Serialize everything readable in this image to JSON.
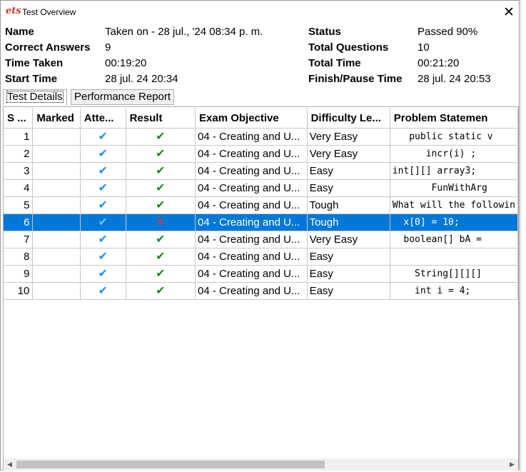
{
  "window": {
    "title": "Test Overview",
    "logo": "ets",
    "close": "✕"
  },
  "summary": {
    "name_label": "Name",
    "name_value": "Taken on - 28 jul., '24 08:34 p. m.",
    "correct_label": "Correct Answers",
    "correct_value": "9",
    "time_taken_label": "Time Taken",
    "time_taken_value": "00:19:20",
    "start_label": "Start Time",
    "start_value": "28 jul. 24 20:34",
    "status_label": "Status",
    "status_value": "Passed 90%",
    "total_q_label": "Total Questions",
    "total_q_value": "10",
    "total_time_label": "Total Time",
    "total_time_value": "00:21:20",
    "finish_label": "Finish/Pause Time",
    "finish_value": "28 jul. 24 20:53"
  },
  "tabs": [
    "Test Details",
    "Performance Report"
  ],
  "table": {
    "headers": [
      "S ...",
      "Marked",
      "Atte...",
      "Result",
      "Exam Objective",
      "Difficulty Le...",
      "Problem Statemen"
    ],
    "rows": [
      {
        "n": "1",
        "result": "pass",
        "objective": "04 - Creating and U...",
        "difficulty": "Very Easy",
        "problem": "   public static v"
      },
      {
        "n": "2",
        "result": "pass",
        "objective": "04 - Creating and U...",
        "difficulty": "Very Easy",
        "problem": "      incr(i) ;"
      },
      {
        "n": "3",
        "result": "pass",
        "objective": "04 - Creating and U...",
        "difficulty": "Easy",
        "problem": "int[][] array3;"
      },
      {
        "n": "4",
        "result": "pass",
        "objective": "04 - Creating and U...",
        "difficulty": "Easy",
        "problem": "       FunWithArg"
      },
      {
        "n": "5",
        "result": "pass",
        "objective": "04 - Creating and U...",
        "difficulty": "Tough",
        "problem": "What will the followin"
      },
      {
        "n": "6",
        "result": "fail",
        "objective": "04 - Creating and U...",
        "difficulty": "Tough",
        "problem": "  x[0] = 10;"
      },
      {
        "n": "7",
        "result": "pass",
        "objective": "04 - Creating and U...",
        "difficulty": "Very Easy",
        "problem": "  boolean[] bA ="
      },
      {
        "n": "8",
        "result": "pass",
        "objective": "04 - Creating and U...",
        "difficulty": "Easy",
        "problem": ""
      },
      {
        "n": "9",
        "result": "pass",
        "objective": "04 - Creating and U...",
        "difficulty": "Easy",
        "problem": "    String[][][]"
      },
      {
        "n": "10",
        "result": "pass",
        "objective": "04 - Creating and U...",
        "difficulty": "Easy",
        "problem": "    int i = 4;"
      }
    ],
    "selected_row": 5,
    "attempted_symbol": "✔",
    "pass_symbol": "✔",
    "fail_symbol": "✕"
  },
  "colors": {
    "selection": "#0078d7",
    "pass": "#1d8a1d",
    "fail": "#d93a3a",
    "attempted": "#1e90e6"
  },
  "scroll": {
    "left": "◀",
    "right": "▶"
  }
}
